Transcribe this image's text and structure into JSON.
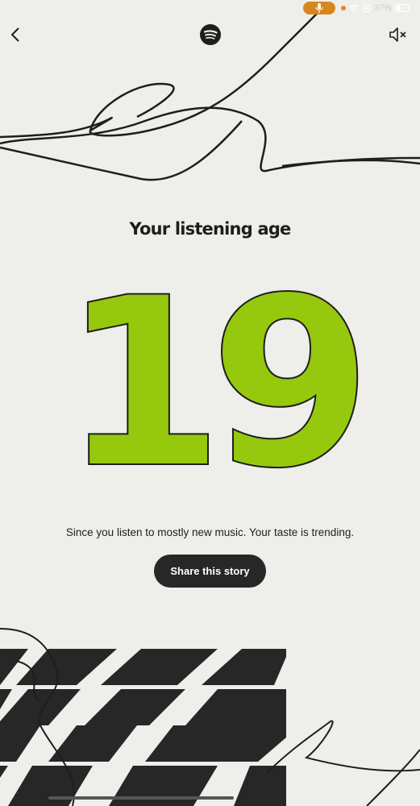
{
  "status_bar": {
    "battery_text": "37%",
    "battery_level": 0.37,
    "icons": [
      "microphone-icon",
      "wifi-icon",
      "data-icon",
      "battery-icon"
    ],
    "mic_pill_color": "#d8871e"
  },
  "top_bar": {
    "back_icon": "chevron-left-icon",
    "logo_icon": "spotify-logo-icon",
    "mute_icon": "speaker-muted-icon"
  },
  "story": {
    "headline": "Your listening age",
    "age_value": "19",
    "caption": "Since you listen to mostly new music. Your taste is trending.",
    "share_label": "Share this story"
  },
  "colors": {
    "background": "#eeeeea",
    "accent_green": "#96c80e",
    "dark": "#272727"
  }
}
